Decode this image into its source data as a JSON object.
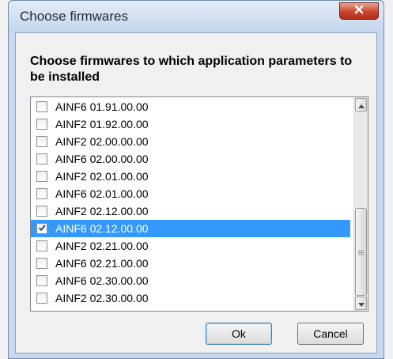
{
  "window": {
    "title": "Choose firmwares",
    "close_symbol": "x"
  },
  "prompt": "Choose firmwares to which application parameters to be installed",
  "firmware_list": [
    {
      "label": "AINF6 01.91.00.00",
      "checked": false,
      "selected": false
    },
    {
      "label": "AINF2 01.92.00.00",
      "checked": false,
      "selected": false
    },
    {
      "label": "AINF2 02.00.00.00",
      "checked": false,
      "selected": false
    },
    {
      "label": "AINF6 02.00.00.00",
      "checked": false,
      "selected": false
    },
    {
      "label": "AINF2 02.01.00.00",
      "checked": false,
      "selected": false
    },
    {
      "label": "AINF6 02.01.00.00",
      "checked": false,
      "selected": false
    },
    {
      "label": "AINF2 02.12.00.00",
      "checked": false,
      "selected": false
    },
    {
      "label": "AINF6 02.12.00.00",
      "checked": true,
      "selected": true
    },
    {
      "label": "AINF2 02.21.00.00",
      "checked": false,
      "selected": false
    },
    {
      "label": "AINF6 02.21.00.00",
      "checked": false,
      "selected": false
    },
    {
      "label": "AINF6 02.30.00.00",
      "checked": false,
      "selected": false
    },
    {
      "label": "AINF2 02.30.00.00",
      "checked": false,
      "selected": false
    }
  ],
  "buttons": {
    "ok_label": "Ok",
    "cancel_label": "Cancel"
  },
  "colors": {
    "selection": "#3399ff",
    "close_button": "#c8442b"
  }
}
